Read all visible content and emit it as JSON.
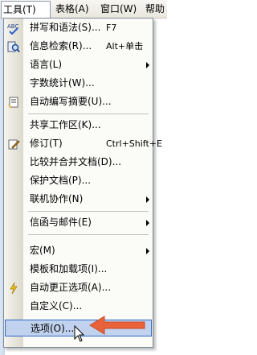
{
  "menubar": {
    "items": [
      "工具(T)",
      "表格(A)",
      "窗口(W)",
      "帮助"
    ]
  },
  "menu": {
    "items": [
      {
        "label": "拼写和语法(S)...",
        "shortcut": "F7",
        "icon": "spellcheck-icon"
      },
      {
        "label": "信息检索(R)...",
        "shortcut": "Alt+单击",
        "icon": "research-icon"
      },
      {
        "label": "语言(L)",
        "submenu": true
      },
      {
        "label": "字数统计(W)..."
      },
      {
        "label": "自动编写摘要(U)...",
        "icon": "autosummarize-icon"
      },
      {
        "label": "共享工作区(K)..."
      },
      {
        "label": "修订(T)",
        "shortcut": "Ctrl+Shift+E",
        "icon": "track-changes-icon"
      },
      {
        "label": "比较并合并文档(D)..."
      },
      {
        "label": "保护文档(P)..."
      },
      {
        "label": "联机协作(N)",
        "submenu": true
      },
      {
        "label": "信函与邮件(E)",
        "submenu": true
      },
      {
        "label": "宏(M)",
        "submenu": true
      },
      {
        "label": "模板和加载项(I)..."
      },
      {
        "label": "自动更正选项(A)...",
        "icon": "autocorrect-icon"
      },
      {
        "label": "自定义(C)..."
      },
      {
        "label": "选项(O)...",
        "selected": true
      }
    ]
  },
  "colors": {
    "highlight": "#c1d2ee",
    "highlight_border": "#316ac5",
    "annotation_arrow": "#e8623a"
  }
}
